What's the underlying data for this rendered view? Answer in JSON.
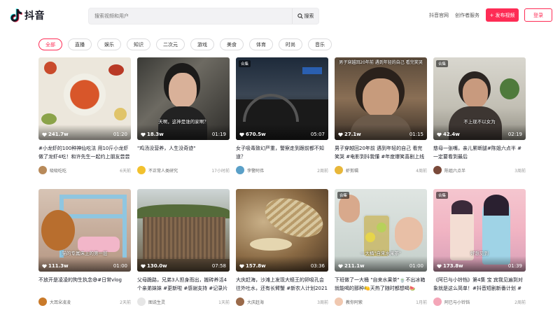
{
  "header": {
    "logo_text": "抖音",
    "search_placeholder": "搜索视频和用户",
    "search_button": "搜索",
    "link_official": "抖音官网",
    "link_creator": "创作者服务",
    "upload_button": "+ 发布视频",
    "login_button": "登录"
  },
  "categories": [
    "全部",
    "直播",
    "娱乐",
    "知识",
    "二次元",
    "游戏",
    "美食",
    "体育",
    "时尚",
    "音乐"
  ],
  "active_category": "全部",
  "videos": [
    {
      "likes": "241.7w",
      "duration": "01:20",
      "badge": "",
      "caption": "",
      "title": "#小龙虾的100种神仙吃法 用10斤小龙虾做了龙虾4吃！和许先生一起约上朋友尝尝~...",
      "author": "吸吸吃吃",
      "posted": "6天前"
    },
    {
      "likes": "18.3w",
      "duration": "01:19",
      "badge": "",
      "caption": "天啊，这神是谁的家啊？",
      "title": "\"鸡汤没营养，人生没奇迹\"",
      "author": "不正常人类研究",
      "posted": "17小时前"
    },
    {
      "likes": "670.5w",
      "duration": "05:07",
      "badge": "合集",
      "caption": "",
      "title": "女子吸毒致幻严重，警察走到跟前都不知道？",
      "author": "李警阿伟",
      "posted": "2周前"
    },
    {
      "likes": "27.1w",
      "duration": "01:15",
      "badge": "",
      "caption": "男子穿越回20年前 遇到年轻的自己 看完笑哭",
      "title": "男子穿越回20年前 遇到年轻的自己 看完笑哭 #电影到抖我懂 #年度爆笑喜剧上线",
      "author": "虾剪辑",
      "posted": "4周前"
    },
    {
      "likes": "42.4w",
      "duration": "02:19",
      "badge": "合集",
      "caption": "不上现不以女为",
      "title": "慈母一张嘴，亲儿累断腿#陈姐六点半 #一定要看到最后",
      "author": "陈姐六点半",
      "posted": "3周前"
    },
    {
      "likes": "111.3w",
      "duration": "01:00",
      "badge": "",
      "caption": "猫的专属床上的第一层",
      "title": "不放开是凌凌的狗生执念😅#日常vlog",
      "author": "大耳朵凌凌",
      "posted": "2天前"
    },
    {
      "likes": "130.0w",
      "duration": "07:58",
      "badge": "",
      "caption": "",
      "title": "父母跪路，兄弟3人担身而出，搬砖养活4个亲弟妹妹 #更新啦 #感谢支持 #记录片解说...",
      "author": "图说生灵",
      "posted": "1天前"
    },
    {
      "likes": "157.8w",
      "duration": "03:36",
      "badge": "",
      "caption": "",
      "title": "大庆赶海，沙滩上发现大蛏王的卵吸孔会往外吐水，还有长臂蟹 #新农人计划2021",
      "author": "大庆赶海",
      "posted": "3周前"
    },
    {
      "likes": "211.1w",
      "duration": "01:00",
      "badge": "合集",
      "caption": "一大桶\"自来水果茶\"",
      "title": "下班做了一大桶 \"自来水果茶\"🍵不出冰箱就能喝的那种🍋天热了随时都想喝🍉 #vlo...",
      "author": "教你阿紫",
      "posted": "1月前"
    },
    {
      "likes": "173.8w",
      "duration": "01:39",
      "badge": "合集",
      "caption": "好想见到",
      "title": "《阿巳与小铃铛》第4集 宝 宾我见遍到对象就是这么简单！#抖音短剧新番计划 #轻漫计...",
      "author": "阿巳与小铃铛",
      "posted": "2周前"
    }
  ],
  "colors": {
    "brand": "#fe2c55",
    "text": "#161823"
  }
}
